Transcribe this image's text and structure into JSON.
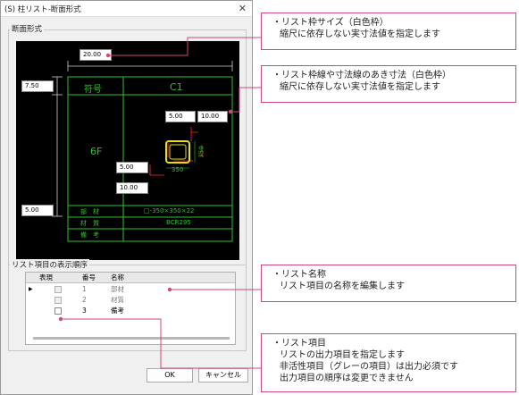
{
  "dialog": {
    "title": "(S) 柱リスト-断面形式",
    "close_icon": "close-icon",
    "section_group_label": "断面形式",
    "order_group_label": "リスト項目の表示順序",
    "ok_label": "OK",
    "cancel_label": "キャンセル"
  },
  "preview": {
    "frame_width_value": "20.00",
    "row_height_value": "7.50",
    "bottom_height_value": "5.00",
    "gap_value_1": "5.00",
    "gap_value_2": "10.00",
    "dim_value_3": "5.00",
    "dim_value_4": "10.00",
    "header_symbol": "符号",
    "header_name": "C1",
    "floor_label": "6F",
    "dim_350_h": "350",
    "dim_350_v": "350",
    "row_member_label": "部　材",
    "row_member_value": "□-350×350×22",
    "row_material_label": "材　質",
    "row_material_value": "BCR295",
    "row_note_label": "備　考",
    "colors": {
      "cad_line": "#2fc32f",
      "column": "#e8e000",
      "dim": "#ff2a2a"
    }
  },
  "grid": {
    "headers": [
      "表現",
      "番号",
      "名称"
    ],
    "rows": [
      {
        "number": "1",
        "name": "部材",
        "disabled": true,
        "selected": true
      },
      {
        "number": "2",
        "name": "材質",
        "disabled": true,
        "selected": false
      },
      {
        "number": "3",
        "name": "備考",
        "disabled": false,
        "selected": false
      }
    ]
  },
  "callouts": {
    "c1": [
      "・リスト枠サイズ（白色枠）",
      "縮尺に依存しない実寸法値を指定します"
    ],
    "c2": [
      "・リスト枠線や寸法線のあき寸法（白色枠）",
      "縮尺に依存しない実寸法値を指定します"
    ],
    "c3": [
      "・リスト名称",
      "リスト項目の名称を編集します"
    ],
    "c4": [
      "・リスト項目",
      "リストの出力項目を指定します",
      "非活性項目（グレーの項目）は出力必須です",
      "出力項目の順序は変更できません"
    ]
  },
  "accent_color": "#d2467f"
}
